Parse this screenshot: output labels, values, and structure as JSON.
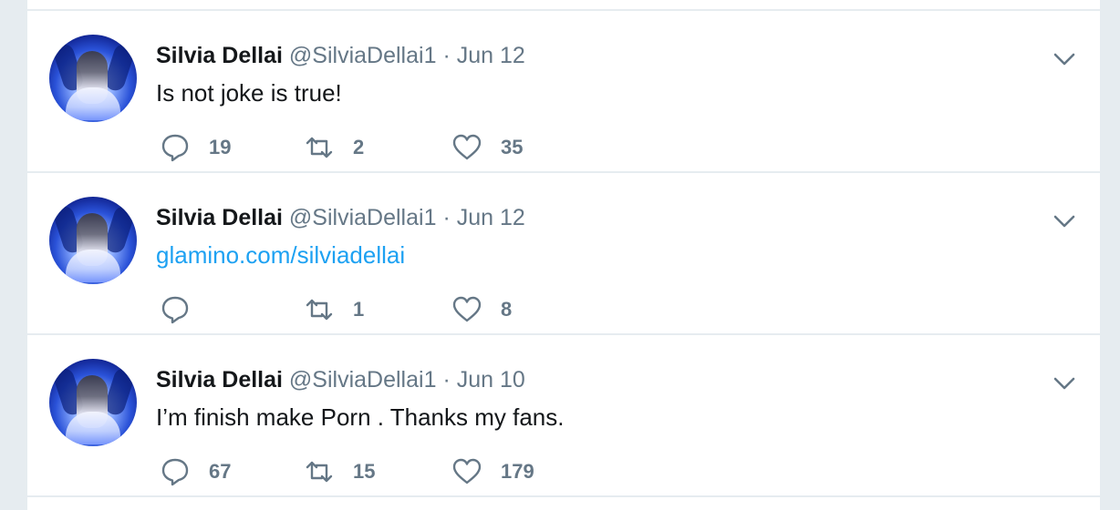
{
  "tweets": [
    {
      "display_name": "Silvia Dellai",
      "handle": "@SilviaDellai1",
      "separator": "·",
      "date": "Jun 12",
      "text": "Is not joke is true!",
      "text_is_link": false,
      "reply_count": "19",
      "retweet_count": "2",
      "like_count": "35"
    },
    {
      "display_name": "Silvia Dellai",
      "handle": "@SilviaDellai1",
      "separator": "·",
      "date": "Jun 12",
      "text": "glamino.com/silviadellai",
      "text_is_link": true,
      "reply_count": "",
      "retweet_count": "1",
      "like_count": "8"
    },
    {
      "display_name": "Silvia Dellai",
      "handle": "@SilviaDellai1",
      "separator": "·",
      "date": "Jun 10",
      "text": "I’m finish make Porn . Thanks my fans.",
      "text_is_link": false,
      "reply_count": "67",
      "retweet_count": "15",
      "like_count": "179"
    }
  ],
  "icons": {
    "reply": "reply-icon",
    "retweet": "retweet-icon",
    "like": "heart-icon",
    "menu": "chevron-down-icon"
  },
  "colors": {
    "background": "#e6ecf0",
    "card": "#ffffff",
    "primary_text": "#14171a",
    "secondary_text": "#657786",
    "link": "#1da1f2"
  }
}
